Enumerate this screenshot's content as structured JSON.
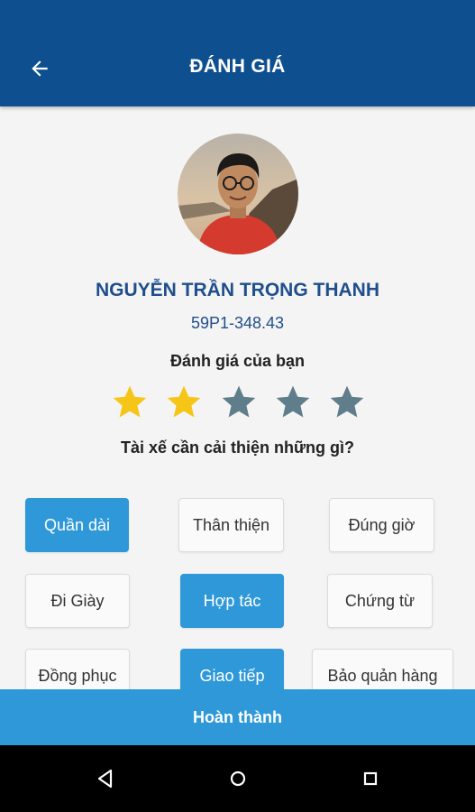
{
  "header": {
    "title": "ĐÁNH GIÁ",
    "back_icon": "arrow-left-icon"
  },
  "driver": {
    "name": "NGUYỄN TRẦN TRỌNG THANH",
    "plate": "59P1-348.43"
  },
  "rating": {
    "label": "Đánh giá của bạn",
    "value": 2,
    "max": 5,
    "filled_color": "#f5c518",
    "empty_color": "#607d8b"
  },
  "improvement": {
    "question": "Tài xế cần cải thiện những gì?",
    "options": [
      {
        "label": "Quần dài",
        "selected": true
      },
      {
        "label": "Thân thiện",
        "selected": false
      },
      {
        "label": "Đúng giờ",
        "selected": false
      },
      {
        "label": "Đi Giày",
        "selected": false
      },
      {
        "label": "Hợp tác",
        "selected": true
      },
      {
        "label": "Chứng từ",
        "selected": false
      },
      {
        "label": "Đồng phục",
        "selected": false
      },
      {
        "label": "Giao tiếp",
        "selected": true
      },
      {
        "label": "Bảo quản hàng",
        "selected": false
      }
    ]
  },
  "footer": {
    "submit_label": "Hoàn thành"
  },
  "colors": {
    "header_bg": "#0d4f8f",
    "accent": "#2f98d8",
    "name_text": "#1f4e8c"
  },
  "nav": {
    "icons": [
      "back-triangle-icon",
      "home-circle-icon",
      "recents-square-icon"
    ]
  }
}
